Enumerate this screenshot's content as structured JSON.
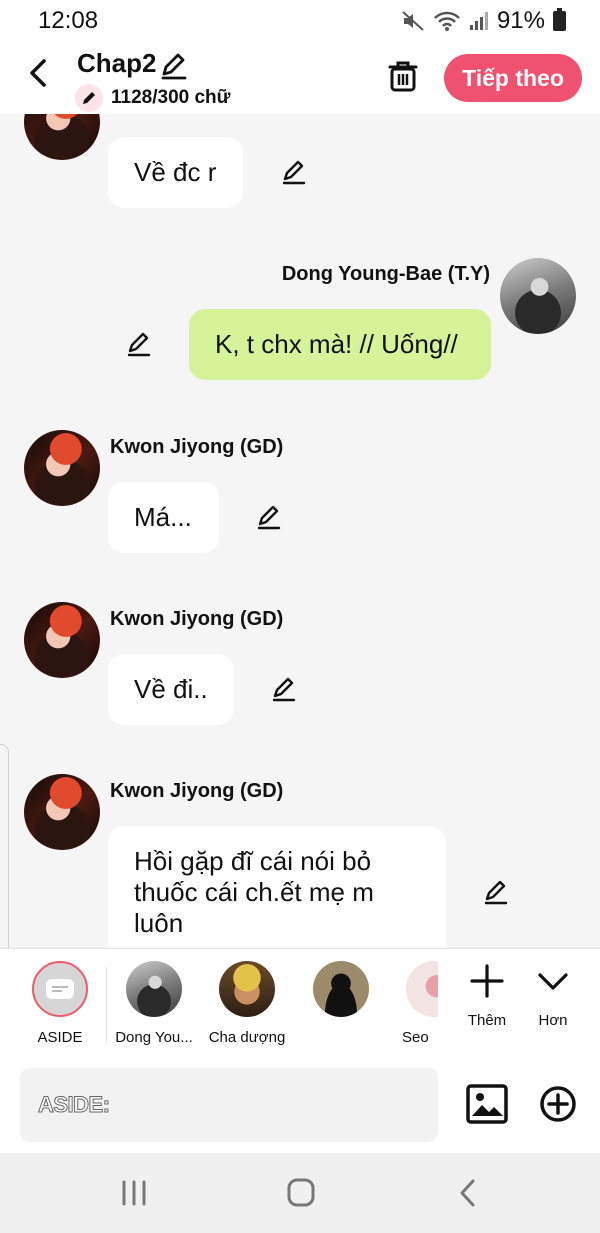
{
  "status_bar": {
    "time": "12:08",
    "battery": "91%"
  },
  "header": {
    "title": "Chap2",
    "word_count": "1128/300 chữ",
    "next_label": "Tiếp theo",
    "accent": "#f0516f"
  },
  "messages": [
    {
      "sender": "",
      "text": "Về đc r",
      "side": "left"
    },
    {
      "sender": "Dong Young-Bae (T.Y)",
      "text": "K, t chx mà! // Uống//",
      "side": "right"
    },
    {
      "sender": "Kwon Jiyong (GD)",
      "text": "Má...",
      "side": "left"
    },
    {
      "sender": "Kwon Jiyong (GD)",
      "text": "Về đi..",
      "side": "left"
    },
    {
      "sender": "Kwon Jiyong (GD)",
      "lines": [
        "Hồi gặp đĩ cái nói bỏ",
        "thuốc cái ch.ết mẹ m",
        "luôn"
      ],
      "side": "left"
    }
  ],
  "characters": [
    {
      "label": "ASIDE"
    },
    {
      "label": "Dong You..."
    },
    {
      "label": "Cha dượng"
    },
    {
      "label": ""
    },
    {
      "label": "Seo"
    }
  ],
  "actions": {
    "add": "Thêm",
    "more": "Hơn"
  },
  "input": {
    "placeholder": "ASIDE:"
  }
}
